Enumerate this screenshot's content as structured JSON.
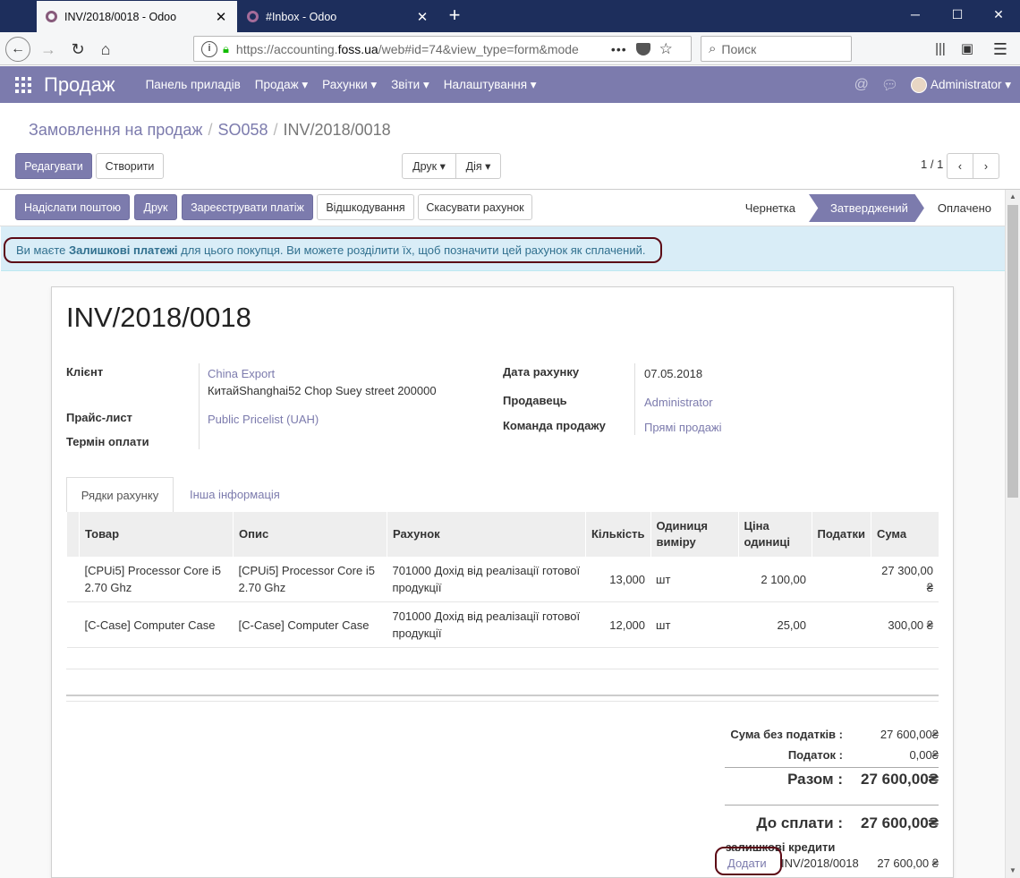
{
  "browser": {
    "tabs": [
      {
        "title": "INV/2018/0018 - Odoo"
      },
      {
        "title": "#Inbox - Odoo"
      }
    ],
    "url_prefix": "https://accounting.",
    "url_domain": "foss.ua",
    "url_suffix": "/web#id=74&view_type=form&mode",
    "search_placeholder": "Поиск"
  },
  "odoo": {
    "brand": "Продаж",
    "menu": [
      "Панель приладів",
      "Продаж ▾",
      "Рахунки ▾",
      "Звіти ▾",
      "Налаштування ▾"
    ],
    "user": "Administrator ▾"
  },
  "breadcrumb": {
    "root": "Замовлення на продаж",
    "middle": "SO058",
    "current": "INV/2018/0018"
  },
  "control": {
    "edit": "Редагувати",
    "create": "Створити",
    "print": "Друк ▾",
    "action": "Дія ▾",
    "pager": "1 / 1"
  },
  "header_buttons": {
    "send": "Надіслати поштою",
    "print": "Друк",
    "register": "Зареєструвати платіж",
    "debug": "Відшкодування",
    "cancel": "Скасувати рахунок"
  },
  "stages": [
    "Чернетка",
    "Затверджений",
    "Оплачено"
  ],
  "alert": {
    "before": "Ви маєте ",
    "bold": "Залишкові платежі",
    "after": " для цього покупця. Ви можете розділити їх, щоб позначити цей рахунок як сплачений."
  },
  "invoice": {
    "number": "INV/2018/0018",
    "labels": {
      "customer": "Клієнт",
      "pricelist": "Прайс-лист",
      "terms": "Термін оплати",
      "date": "Дата рахунку",
      "salesperson": "Продавець",
      "team": "Команда продажу"
    },
    "customer_name": "China Export",
    "customer_address": "КитайShanghai52 Chop Suey street 200000",
    "pricelist": "Public Pricelist (UAH)",
    "date": "07.05.2018",
    "salesperson": "Administrator",
    "team": "Прямі продажі"
  },
  "tabs": [
    "Рядки рахунку",
    "Інша інформація"
  ],
  "lines": {
    "headers": [
      "Товар",
      "Опис",
      "Рахунок",
      "Кількість",
      "Одиниця виміру",
      "Ціна одиниці",
      "Податки",
      "Сума"
    ],
    "rows": [
      {
        "product": "[CPUi5] Processor Core i5 2.70 Ghz",
        "desc": "[CPUi5] Processor Core i5 2.70 Ghz",
        "account": "701000 Дохід від реалізації готової продукції",
        "qty": "13,000",
        "uom": "шт",
        "price": "2 100,00",
        "tax": "",
        "total": "27 300,00 ₴"
      },
      {
        "product": "[C-Case] Computer Case",
        "desc": "[C-Case] Computer Case",
        "account": "701000 Дохід від реалізації готової продукції",
        "qty": "12,000",
        "uom": "шт",
        "price": "25,00",
        "tax": "",
        "total": "300,00 ₴"
      }
    ]
  },
  "totals": {
    "untaxed_label": "Сума без податків :",
    "untaxed": "27 600,00₴",
    "tax_label": "Податок :",
    "tax": "0,00₴",
    "total_label": "Разом :",
    "total": "27 600,00₴",
    "due_label": "До сплати :",
    "due": "27 600,00₴",
    "credits_label": "залишкові кредити",
    "add_link": "Додати",
    "credit_ref": "INV/2018/0018",
    "credit_amount": "27 600,00 ₴"
  },
  "colors": {
    "brand": "#7c7bad",
    "alert_bg": "#d9edf7",
    "alert_text": "#31708f",
    "annotation": "#5c0a15"
  }
}
